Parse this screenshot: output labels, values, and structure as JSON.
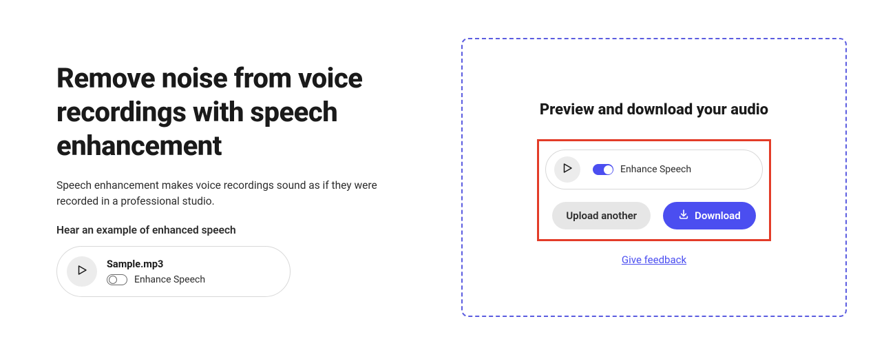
{
  "left": {
    "headline": "Remove noise from voice recordings with speech enhancement",
    "subhead": "Speech enhancement makes voice recordings sound as if they were recorded in a professional studio.",
    "example_label": "Hear an example of enhanced speech",
    "sample": {
      "filename": "Sample.mp3",
      "toggle_label": "Enhance Speech"
    }
  },
  "panel": {
    "title": "Preview and download your audio",
    "toggle_label": "Enhance Speech",
    "upload_another": "Upload another",
    "download": "Download",
    "feedback": "Give feedback"
  }
}
